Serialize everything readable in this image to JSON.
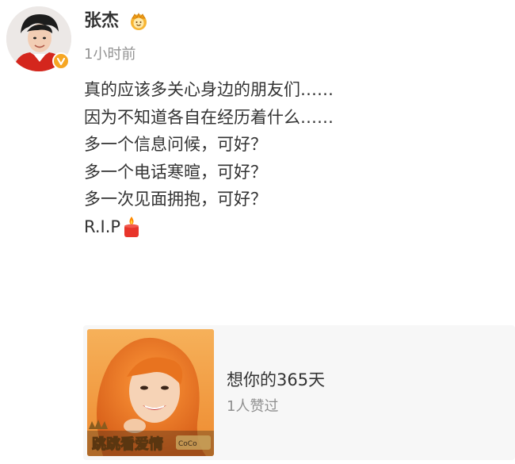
{
  "user": {
    "name": "张杰",
    "timestamp": "1小时前",
    "avatar_icon": "avatar-portrait",
    "verified_icon": "verified-v-icon",
    "badge_icon": "crown-badge-icon"
  },
  "post": {
    "lines": [
      "真的应该多关心身边的朋友们……",
      "因为不知道各自在经历着什么……",
      "多一个信息问候，可好？",
      "多一个电话寒暄，可好？",
      "多一次见面拥抱，可好？",
      "R.I.P"
    ],
    "emoji_icon": "candle-icon"
  },
  "music_card": {
    "title": "想你的365天",
    "likes": "1人赞过",
    "cover_text": "跳跳看爱情"
  },
  "colors": {
    "text": "#333333",
    "secondary": "#939393",
    "card_bg": "#f7f7f7",
    "accent_orange": "#f6a623"
  }
}
